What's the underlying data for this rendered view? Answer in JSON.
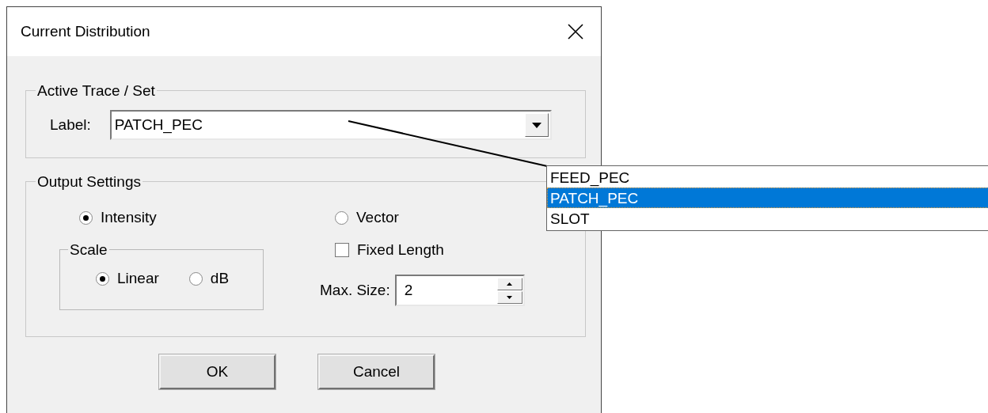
{
  "window": {
    "title": "Current Distribution"
  },
  "active_trace": {
    "title": "Active Trace / Set",
    "label": "Label:",
    "value": "PATCH_PEC",
    "expanded": true,
    "options": [
      {
        "label": "FEED_PEC",
        "selected": false
      },
      {
        "label": "PATCH_PEC",
        "selected": true
      },
      {
        "label": "SLOT",
        "selected": false
      }
    ]
  },
  "output_settings": {
    "title": "Output Settings",
    "modes": [
      {
        "label": "Intensity",
        "selected": true
      },
      {
        "label": "Vector",
        "selected": false
      }
    ],
    "scale": {
      "title": "Scale",
      "options": [
        {
          "label": "Linear",
          "selected": true
        },
        {
          "label": "dB",
          "selected": false
        }
      ]
    },
    "fixed_length": {
      "label": "Fixed Length",
      "checked": false
    },
    "max_size": {
      "label": "Max. Size:",
      "value": "2"
    }
  },
  "buttons": [
    "OK",
    "Cancel"
  ]
}
